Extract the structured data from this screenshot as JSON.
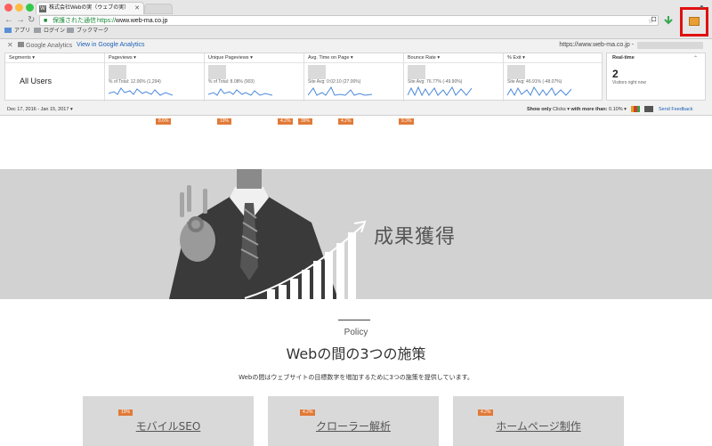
{
  "browser": {
    "tab_title": "株式会社Webの実（ウェブの実）",
    "tab_favicon": "W",
    "secure_label": "保護された通信",
    "url_scheme": "https://",
    "url_host": "www.web-ma.co.jp",
    "bookmarks": [
      "アプリ",
      "ログイン",
      "ブックマーク"
    ],
    "icons": [
      "back-icon",
      "forward-icon",
      "reload-icon",
      "lock-icon",
      "star-icon",
      "download-icon",
      "extension-icon"
    ]
  },
  "analytics": {
    "product_name": "Google Analytics",
    "view_link": "View in Google Analytics",
    "site": "https://www.web-ma.co.jp -",
    "segment_header": "Segments ▾",
    "segment_value": "All Users",
    "metrics": [
      {
        "label": "Pageviews ▾",
        "sub": "% of Total: 12.06% (1,294)"
      },
      {
        "label": "Unique Pageviews ▾",
        "sub": "% of Total: 8.08% (903)"
      },
      {
        "label": "Avg. Time on Page ▾",
        "sub": "Site Avg: 0:02:10 (27.00%)"
      },
      {
        "label": "Bounce Rate ▾",
        "sub": "Site Avg: 76.77% (-49.90%)"
      },
      {
        "label": "% Exit ▾",
        "sub": "Site Avg: 46.91% (-48.07%)"
      }
    ],
    "realtime_label": "Real-time",
    "realtime_count": "2",
    "realtime_sub": "Visitors right now",
    "date_range": "Dec 17, 2016 - Jan 15, 2017 ▾",
    "show_only": "Show only",
    "clicks": "Clicks ▾",
    "more_than": "with more than:",
    "threshold": "0.10% ▾",
    "feedback": "Send Feedback",
    "accent": "#1a5fb4"
  },
  "page": {
    "badges": [
      {
        "text": "8.6%"
      },
      {
        "text": "19%"
      },
      {
        "text": "4.2%"
      },
      {
        "text": "39%"
      },
      {
        "text": "4.2%"
      },
      {
        "text": "9.3%"
      }
    ],
    "hero_title": "成果獲得",
    "policy_label": "Policy",
    "policy_title": "Webの間の3つの施策",
    "policy_desc": "Webの間はウェブサイトの目標数字を増加するために3つの施策を提供しています。",
    "cards": [
      {
        "title": "モバイルSEO",
        "badge": "19%"
      },
      {
        "title": "クローラー解析",
        "badge": "4.2%"
      },
      {
        "title": "ホームページ制作",
        "badge": "4.2%"
      }
    ],
    "badge_color": "#e17a37",
    "highlight_color": "#e11010"
  }
}
